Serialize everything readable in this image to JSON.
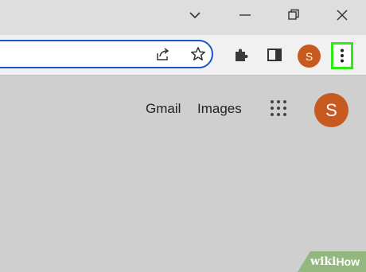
{
  "window": {
    "caption_buttons": [
      {
        "icon": "chevron-down-icon"
      },
      {
        "icon": "minimize-icon"
      },
      {
        "icon": "restore-icon"
      },
      {
        "icon": "close-icon"
      }
    ]
  },
  "toolbar": {
    "omnibox_icons": [
      "share-icon",
      "star-icon"
    ],
    "extensions_icon": "puzzle-icon",
    "side_panel_icon": "side-panel-icon",
    "profile_initial": "S",
    "profile_color": "#c75a1e",
    "menu_icon": "kebab-menu-icon",
    "menu_highlight_color": "#2eeb14",
    "omnibox_focus_color": "#1a56c9"
  },
  "page": {
    "links": [
      "Gmail",
      "Images"
    ],
    "apps_icon": "apps-grid-icon",
    "account_initial": "S",
    "account_color": "#c75a1e"
  },
  "watermark": {
    "prefix": "wiki",
    "suffix": "How"
  }
}
